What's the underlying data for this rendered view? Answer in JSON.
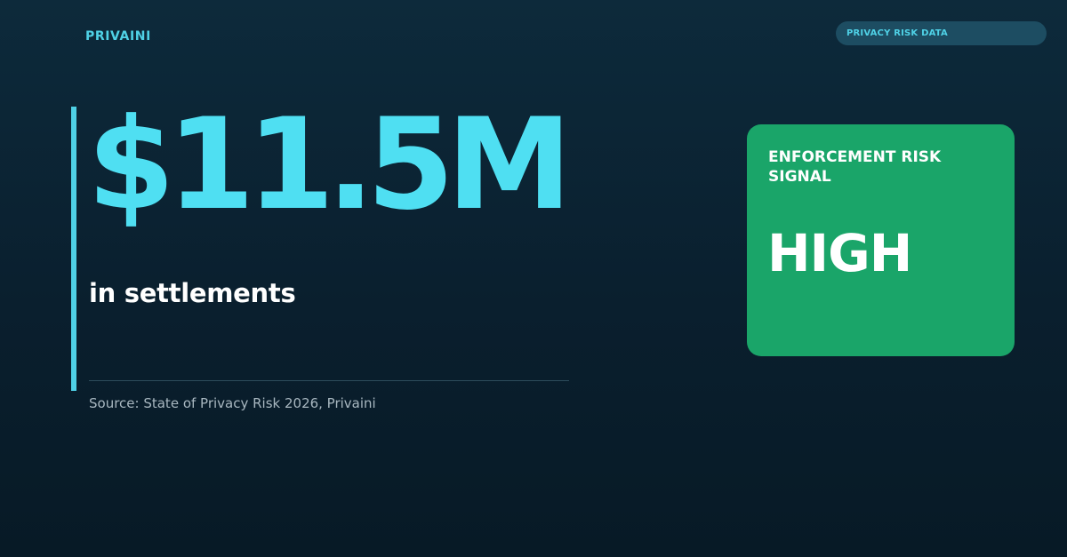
{
  "brand": {
    "name": "PRIVAINI"
  },
  "tag": {
    "label": "PRIVACY RISK DATA"
  },
  "stat": {
    "value": "$11.5M",
    "label": "in settlements",
    "source": "Source: State of Privacy Risk 2026, Privaini"
  },
  "risk_card": {
    "title": "ENFORCEMENT RISK SIGNAL",
    "level": "HIGH",
    "color": "#1aa569"
  },
  "colors": {
    "accent": "#4fd1e6",
    "background": "#0a1f2e",
    "pill_background": "#1d4d62"
  }
}
